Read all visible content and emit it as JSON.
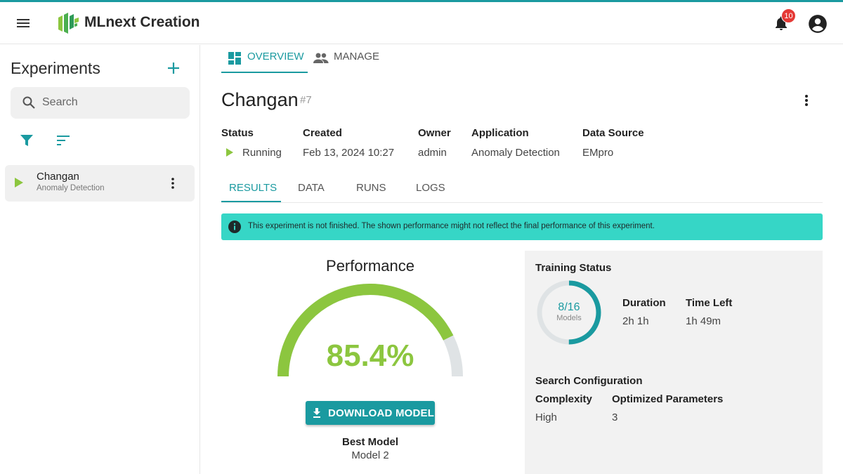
{
  "app": {
    "title": "MLnext Creation",
    "notification_count": "10"
  },
  "sidebar": {
    "title": "Experiments",
    "search_placeholder": "Search",
    "items": [
      {
        "name": "Changan",
        "type": "Anomaly Detection",
        "status": "running"
      }
    ]
  },
  "top_tabs": [
    {
      "label": "OVERVIEW",
      "active": true
    },
    {
      "label": "MANAGE",
      "active": false
    }
  ],
  "experiment": {
    "name": "Changan",
    "number": "#7",
    "meta": {
      "status_label": "Status",
      "status_value": "Running",
      "created_label": "Created",
      "created_value": "Feb 13, 2024 10:27",
      "owner_label": "Owner",
      "owner_value": "admin",
      "application_label": "Application",
      "application_value": "Anomaly Detection",
      "datasource_label": "Data Source",
      "datasource_value": "EMpro"
    }
  },
  "sub_tabs": [
    {
      "label": "RESULTS",
      "active": true
    },
    {
      "label": "DATA",
      "active": false
    },
    {
      "label": "RUNS",
      "active": false
    },
    {
      "label": "LOGS",
      "active": false
    }
  ],
  "banner": {
    "text": "This experiment is not finished. The shown performance might not reflect the final performance of this experiment."
  },
  "performance": {
    "title": "Performance",
    "value_text": "85.4%",
    "value_fraction": 0.854,
    "download_label": "DOWNLOAD MODEL",
    "best_model_label": "Best Model",
    "best_model_value": "Model 2"
  },
  "training": {
    "title": "Training Status",
    "models_done": 8,
    "models_total": 16,
    "models_text": "8/16",
    "models_label": "Models",
    "duration_label": "Duration",
    "duration_value": "2h 1h",
    "time_left_label": "Time Left",
    "time_left_value": "1h 49m",
    "search_config_label": "Search Configuration",
    "complexity_label": "Complexity",
    "complexity_value": "High",
    "optimized_label": "Optimized Parameters",
    "optimized_value": "3"
  },
  "colors": {
    "accent": "#1a9aa0",
    "gauge_green": "#8cc63f",
    "gauge_track": "#dfe3e5",
    "banner": "#36d6c6",
    "badge_red": "#e53935"
  }
}
